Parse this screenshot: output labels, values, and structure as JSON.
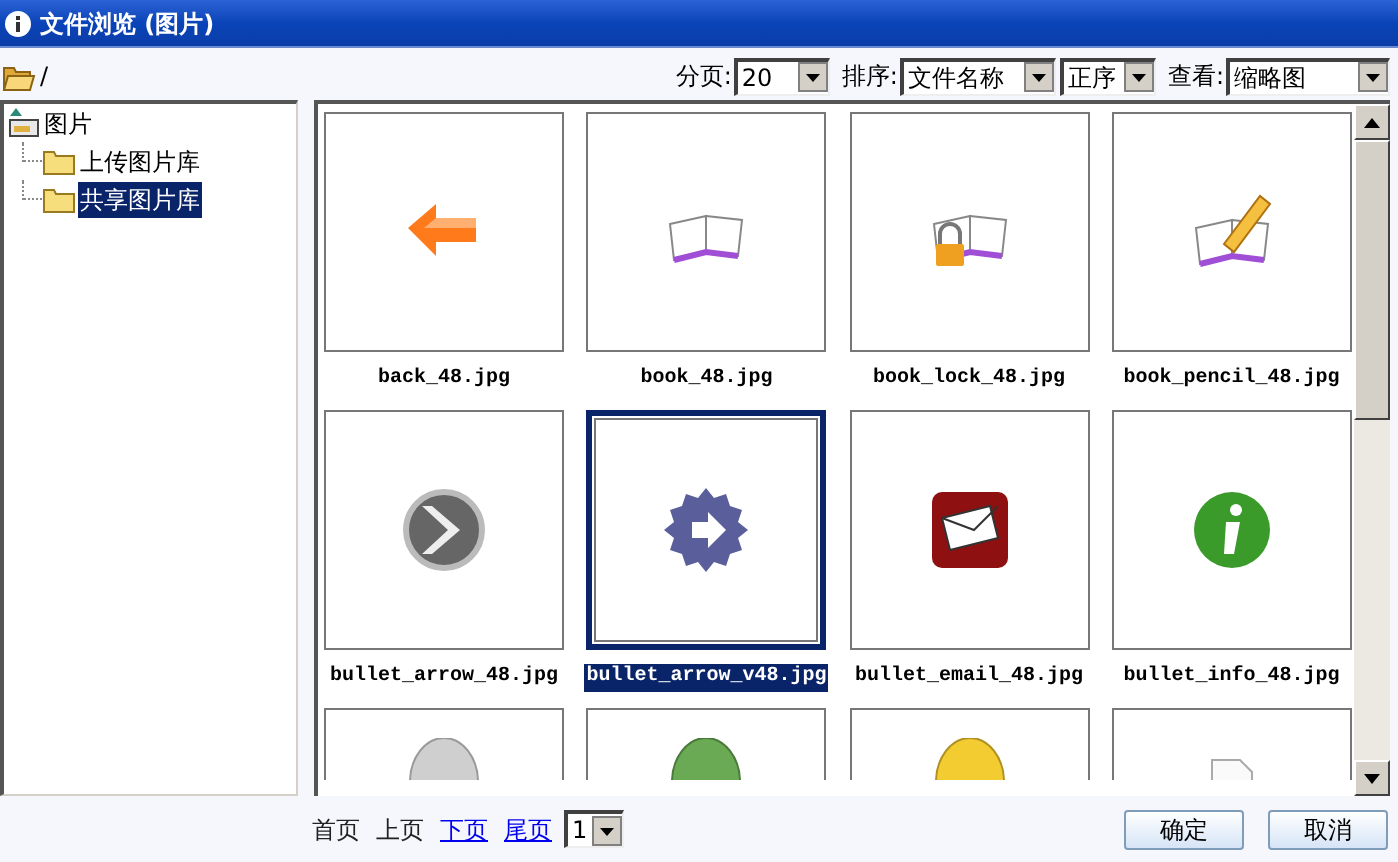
{
  "window": {
    "title": "文件浏览 (图片)"
  },
  "path": "/",
  "toolbar": {
    "page_size": {
      "label": "分页:",
      "value": "20"
    },
    "sort": {
      "label": "排序:",
      "field": "文件名称",
      "order": "正序"
    },
    "view": {
      "label": "查看:",
      "value": "缩略图"
    }
  },
  "tree": {
    "label": "图片",
    "children": [
      {
        "label": "上传图片库",
        "selected": false
      },
      {
        "label": "共享图片库",
        "selected": true
      }
    ]
  },
  "files": [
    {
      "name": "back_48.jpg",
      "kind": "back",
      "selected": false
    },
    {
      "name": "book_48.jpg",
      "kind": "book",
      "selected": false
    },
    {
      "name": "book_lock_48.jpg",
      "kind": "book_lock",
      "selected": false
    },
    {
      "name": "book_pencil_48.jpg",
      "kind": "book_pencil",
      "selected": false
    },
    {
      "name": "bullet_arrow_48.jpg",
      "kind": "bullet_arrow",
      "selected": false
    },
    {
      "name": "bullet_arrow_v48.jpg",
      "kind": "bullet_star",
      "selected": true
    },
    {
      "name": "bullet_email_48.jpg",
      "kind": "email",
      "selected": false
    },
    {
      "name": "bullet_info_48.jpg",
      "kind": "info",
      "selected": false
    },
    {
      "kind": "disc_grey"
    },
    {
      "kind": "disc_green"
    },
    {
      "kind": "disc_yellow"
    },
    {
      "kind": "document"
    }
  ],
  "pager": {
    "links": [
      {
        "label": "首页",
        "link": false
      },
      {
        "label": "上页",
        "link": false
      },
      {
        "label": "下页",
        "link": true
      },
      {
        "label": "尾页",
        "link": true
      }
    ],
    "page": "1"
  },
  "buttons": [
    "确定",
    "取消"
  ]
}
